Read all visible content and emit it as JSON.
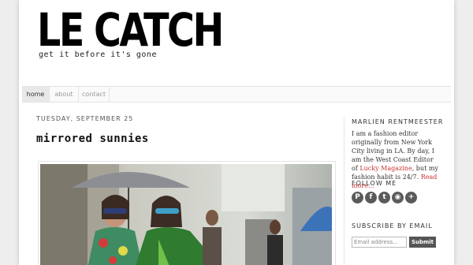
{
  "header": {
    "logo": "LE CATCH",
    "tagline": "get it before it's gone"
  },
  "nav": {
    "items": [
      {
        "label": "home",
        "active": true
      },
      {
        "label": "about",
        "active": false
      },
      {
        "label": "contact",
        "active": false
      }
    ]
  },
  "post": {
    "date": "TUESDAY, SEPTEMBER 25",
    "title": "mirrored sunnies",
    "image_alt": "street style photo"
  },
  "sidebar": {
    "author_title": "MARLIEN RENTMEESTER",
    "bio_1": "I am a fashion editor originally from New York City living in LA. By day, I am the West Coast Editor of ",
    "bio_link": "Lucky Magazine",
    "bio_2": ", but my fashion habit is 24/7. ",
    "read_more": "Read more...",
    "follow_title": "FOLLOW ME",
    "social": [
      {
        "name": "pinterest-icon",
        "glyph": "P"
      },
      {
        "name": "facebook-icon",
        "glyph": "f"
      },
      {
        "name": "twitter-icon",
        "glyph": "t"
      },
      {
        "name": "rss-icon",
        "glyph": "◉"
      },
      {
        "name": "plus-icon",
        "glyph": "+"
      }
    ],
    "subscribe_title": "SUBSCRIBE BY EMAIL",
    "email_placeholder": "Email address...",
    "submit_label": "Submit"
  },
  "colors": {
    "link": "#cc3333",
    "button": "#555555",
    "background": "#eeeeee"
  }
}
